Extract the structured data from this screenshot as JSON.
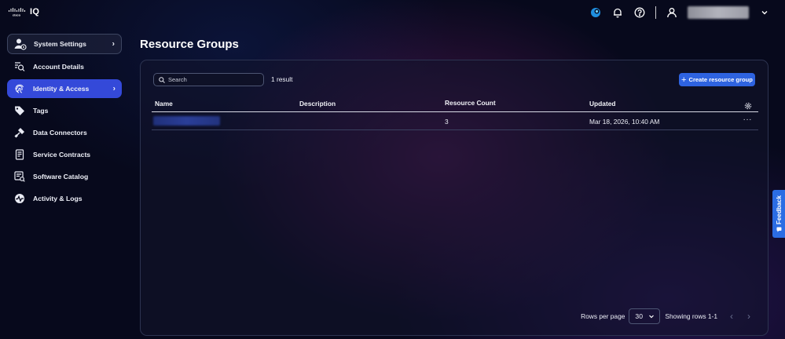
{
  "app": {
    "brand": "cisco",
    "product": "IQ"
  },
  "header": {
    "icons": [
      "assistant-icon",
      "bell-icon",
      "help-icon",
      "user-icon",
      "chevron-down-icon"
    ]
  },
  "sidebar": {
    "items": [
      {
        "label": "System Settings",
        "icon": "settings-user-icon"
      },
      {
        "label": "Account Details",
        "icon": "account-search-icon"
      },
      {
        "label": "Identity & Access",
        "icon": "fingerprint-icon"
      },
      {
        "label": "Tags",
        "icon": "tag-icon"
      },
      {
        "label": "Data Connectors",
        "icon": "plug-icon"
      },
      {
        "label": "Service Contracts",
        "icon": "contract-icon"
      },
      {
        "label": "Software Catalog",
        "icon": "catalog-icon"
      },
      {
        "label": "Activity & Logs",
        "icon": "activity-icon"
      }
    ]
  },
  "page": {
    "title": "Resource Groups"
  },
  "toolbar": {
    "search_placeholder": "Search",
    "result_count": "1 result",
    "create_label": "Create resource group"
  },
  "table": {
    "columns": [
      "Name",
      "Description",
      "Resource Count",
      "Updated"
    ],
    "rows": [
      {
        "name": "",
        "description": "",
        "resource_count": "3",
        "updated": "Mar 18, 2026, 10:40 AM",
        "actions": "···"
      }
    ]
  },
  "pagination": {
    "rows_per_page_label": "Rows per page",
    "rows_per_page_value": "30",
    "showing": "Showing rows 1-1"
  },
  "feedback": {
    "label": "Feedback"
  },
  "colors": {
    "accent": "#3449d9",
    "primary_button": "#2e63e0",
    "feedback_tab": "#2b6de4",
    "background": "#07091c"
  }
}
